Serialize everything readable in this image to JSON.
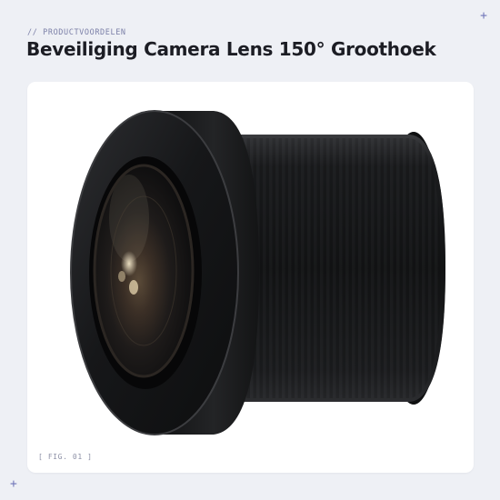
{
  "header": {
    "eyebrow": "// PRODUCTVOORDELEN",
    "title": "Beveiliging Camera Lens 150° Groothoek"
  },
  "figure": {
    "label": "[ FIG. 01 ]",
    "image_subject": "black wide-angle camera lens"
  },
  "decorations": {
    "corner_marker": "+",
    "icon": "plus-icon"
  },
  "colors": {
    "background": "#eef0f5",
    "card": "#ffffff",
    "accent": "#6f74b8",
    "title": "#1c1d24"
  }
}
